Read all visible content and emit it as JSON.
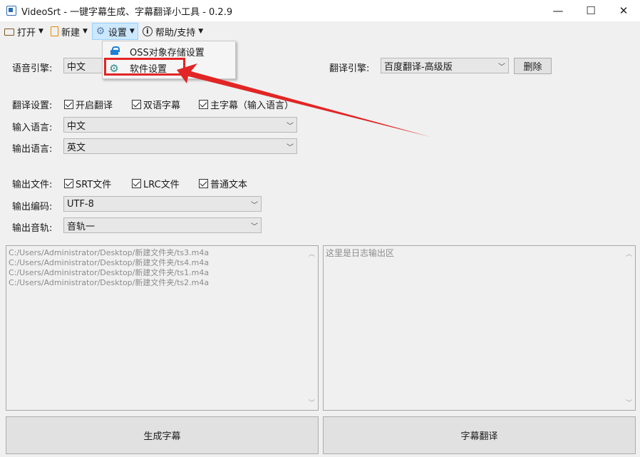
{
  "window": {
    "title": "VideoSrt - 一键字幕生成、字幕翻译小工具 - 0.2.9",
    "minimize": "—",
    "maximize": "☐",
    "close": "✕"
  },
  "menubar": {
    "open": "打开",
    "new": "新建",
    "settings": "设置",
    "help": "帮助/支持"
  },
  "settings_menu": {
    "items": [
      "OSS对象存储设置",
      "软件设置"
    ]
  },
  "form": {
    "speech_engine_label": "语音引擎:",
    "speech_engine_value": "中文",
    "translate_engine_label": "翻译引擎:",
    "translate_engine_value": "百度翻译-高级版",
    "delete_button": "删除",
    "translate_settings_label": "翻译设置:",
    "enable_translate": "开启翻译",
    "bilingual": "双语字幕",
    "main_subtitle": "主字幕（输入语言）",
    "input_lang_label": "输入语言:",
    "input_lang_value": "中文",
    "output_lang_label": "输出语言:",
    "output_lang_value": "英文",
    "output_file_label": "输出文件:",
    "srt_file": "SRT文件",
    "lrc_file": "LRC文件",
    "plain_text": "普通文本",
    "encoding_label": "输出编码:",
    "encoding_value": "UTF-8",
    "track_label": "输出音轨:",
    "track_value": "音轨一"
  },
  "file_list": [
    "C:/Users/Administrator/Desktop/新建文件夹/ts3.m4a",
    "C:/Users/Administrator/Desktop/新建文件夹/ts4.m4a",
    "C:/Users/Administrator/Desktop/新建文件夹/ts1.m4a",
    "C:/Users/Administrator/Desktop/新建文件夹/ts2.m4a"
  ],
  "log_placeholder": "这里是日志输出区",
  "buttons": {
    "generate": "生成字幕",
    "translate": "字幕翻译"
  },
  "colors": {
    "highlight": "#e22525",
    "menu_active": "#cce8ff"
  }
}
